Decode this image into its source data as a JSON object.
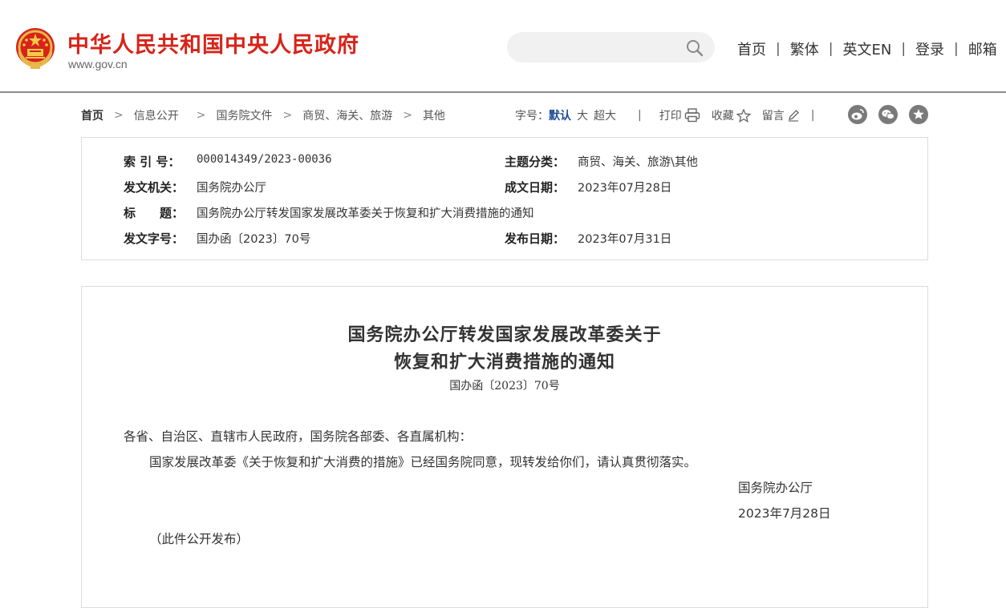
{
  "header": {
    "site_title": "中华人民共和国中央人民政府",
    "site_domain": "www.gov.cn",
    "search_placeholder": "",
    "nav": [
      "首页",
      "繁体",
      "英文EN",
      "登录",
      "邮箱"
    ],
    "brand_color": "#d7241a"
  },
  "breadcrumb": [
    "首页",
    "信息公开",
    "国务院文件",
    "商贸、海关、旅游",
    "其他"
  ],
  "tools": {
    "font_label": "字号：",
    "font_sizes": [
      "默认",
      "大",
      "超大"
    ],
    "print": "打印",
    "favorite": "收藏",
    "comment": "留言",
    "share_icons": [
      "weibo-icon",
      "wechat-icon",
      "star-icon"
    ]
  },
  "info": {
    "index_label": "索 引 号：",
    "index_value": "000014349/2023-00036",
    "topic_label": "主题分类：",
    "topic_value": "商贸、海关、旅游\\其他",
    "issuer_label": "发文机关：",
    "issuer_value": "国务院办公厅",
    "written_label": "成文日期：",
    "written_value": "2023年07月28日",
    "title_label": "标　　题：",
    "title_value": "国务院办公厅转发国家发展改革委关于恢复和扩大消费措施的通知",
    "docno_label": "发文字号：",
    "docno_value": "国办函〔2023〕70号",
    "published_label": "发布日期：",
    "published_value": "2023年07月31日"
  },
  "article": {
    "title_line1": "国务院办公厅转发国家发展改革委关于",
    "title_line2": "恢复和扩大消费措施的通知",
    "doc_number": "国办函〔2023〕70号",
    "salutation": "各省、自治区、直辖市人民政府，国务院各部委、各直属机构：",
    "body": "国家发展改革委《关于恢复和扩大消费的措施》已经国务院同意，现转发给你们，请认真贯彻落实。",
    "signature": "国务院办公厅",
    "date": "2023年7月28日",
    "note": "（此件公开发布）"
  }
}
